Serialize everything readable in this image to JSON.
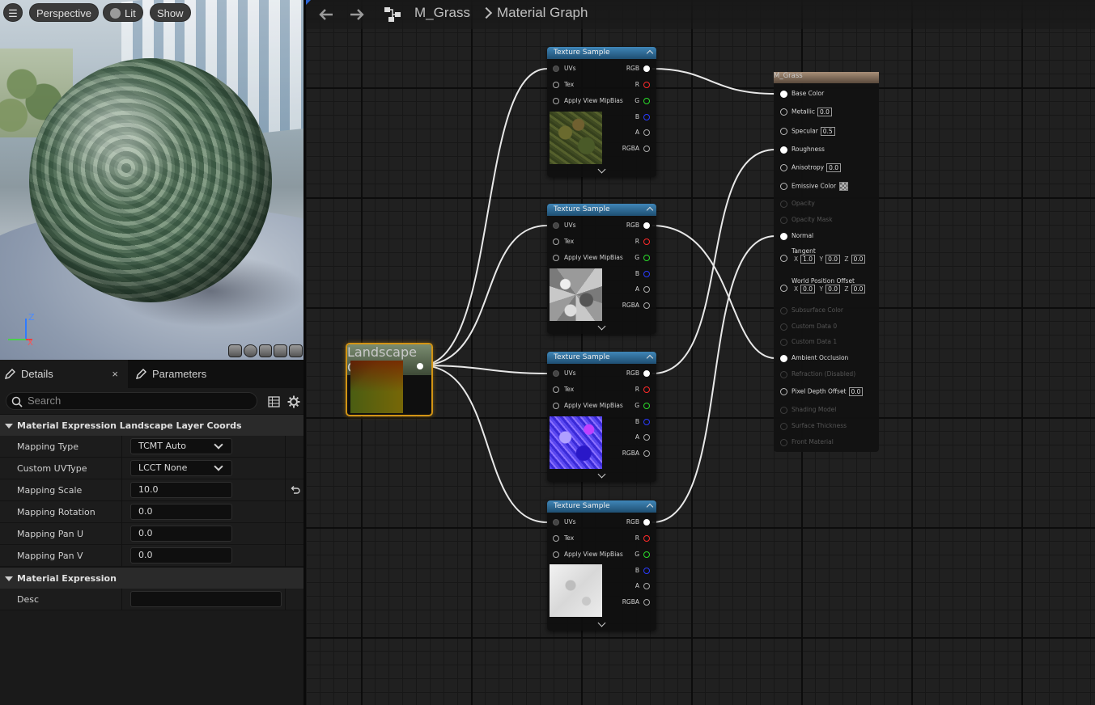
{
  "viewport": {
    "menu_glyph": "☰",
    "perspective_label": "Perspective",
    "lit_label": "Lit",
    "show_label": "Show",
    "axis_z": "Z",
    "axis_x": "X",
    "axis_y": "Y"
  },
  "details": {
    "tab_details": "Details",
    "tab_close": "×",
    "tab_parameters": "Parameters",
    "search_placeholder": "Search",
    "sections": [
      {
        "title": "Material Expression Landscape Layer Coords",
        "props": [
          {
            "label": "Mapping Type",
            "value": "TCMT Auto"
          },
          {
            "label": "Custom UVType",
            "value": "LCCT None"
          },
          {
            "label": "Mapping Scale",
            "value": "10.0"
          },
          {
            "label": "Mapping Rotation",
            "value": "0.0"
          },
          {
            "label": "Mapping Pan U",
            "value": "0.0"
          },
          {
            "label": "Mapping Pan V",
            "value": "0.0"
          }
        ]
      },
      {
        "title": "Material Expression",
        "props": [
          {
            "label": "Desc",
            "value": ""
          }
        ]
      }
    ]
  },
  "graph": {
    "asset_name": "M_Grass",
    "graph_name": "Material Graph",
    "landscape_node_title": "Landscape Coords",
    "texture_nodes": [
      {
        "title": "Texture Sample",
        "in": [
          "UVs",
          "Tex",
          "Apply View MipBias"
        ],
        "out": [
          "RGB",
          "R",
          "G",
          "B",
          "A",
          "RGBA"
        ]
      },
      {
        "title": "Texture Sample",
        "in": [
          "UVs",
          "Tex",
          "Apply View MipBias"
        ],
        "out": [
          "RGB",
          "R",
          "G",
          "B",
          "A",
          "RGBA"
        ]
      },
      {
        "title": "Texture Sample",
        "in": [
          "UVs",
          "Tex",
          "Apply View MipBias"
        ],
        "out": [
          "RGB",
          "R",
          "G",
          "B",
          "A",
          "RGBA"
        ]
      },
      {
        "title": "Texture Sample",
        "in": [
          "UVs",
          "Tex",
          "Apply View MipBias"
        ],
        "out": [
          "RGB",
          "R",
          "G",
          "B",
          "A",
          "RGBA"
        ]
      }
    ],
    "material_node": {
      "title": "M_Grass",
      "pins": {
        "base_color": "Base Color",
        "metallic": "Metallic",
        "metallic_val": "0.0",
        "specular": "Specular",
        "specular_val": "0.5",
        "roughness": "Roughness",
        "anisotropy": "Anisotropy",
        "anisotropy_val": "0.0",
        "emissive": "Emissive Color",
        "opacity": "Opacity",
        "opacity_mask": "Opacity Mask",
        "normal": "Normal",
        "tangent": "Tangent",
        "wpo": "World Position Offset",
        "x": "X",
        "y": "Y",
        "z": "Z",
        "tangent_x": "1.0",
        "tangent_y": "0.0",
        "tangent_z": "0.0",
        "wpo_x": "0.0",
        "wpo_y": "0.0",
        "wpo_z": "0.0",
        "subsurface": "Subsurface Color",
        "custom0": "Custom Data 0",
        "custom1": "Custom Data 1",
        "ao": "Ambient Occlusion",
        "refraction": "Refraction (Disabled)",
        "pdo": "Pixel Depth Offset",
        "pdo_val": "0.0",
        "shading_model": "Shading Model",
        "surface_thickness": "Surface Thickness",
        "front_material": "Front Material"
      }
    }
  },
  "colors": {
    "selection_orange": "#d39414",
    "texture_header": "#2f6f9c",
    "material_header": "#8a7562",
    "pin_r": "#ff2a2a",
    "pin_g": "#2bdc2b",
    "pin_b": "#2a3cff"
  }
}
